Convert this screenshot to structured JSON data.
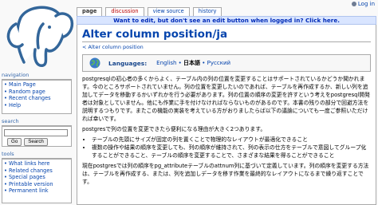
{
  "personal_tools": {
    "login": "Log in"
  },
  "tabs": [
    {
      "label": "page",
      "selected": true
    },
    {
      "label": "discussion",
      "new": true
    },
    {
      "label": "view source"
    },
    {
      "label": "history"
    }
  ],
  "notice": "Want to edit, but don't see an edit button when logged in?  Click here.",
  "title": "Alter column position/ja",
  "breadcrumb": "< Alter column position",
  "languages": {
    "label": "Languages:",
    "links": [
      "English",
      "日本語",
      "Русский"
    ],
    "separator": "•"
  },
  "content": {
    "p1": "postgresqlの初心者の多くからよく、テーブル内の列の位置を変更することはサポートされているかどうか聞かれます。今のところサポートされていません。列の位置を変更したいのであれば、テーブルを再作成するか、新しい列を追加してデータを移動するかいずれかを行う必要があります。列の位置の順序の変更を許すという考えをpostgresql開発者は対象としていません。他にも作業に手を付けなければならないものがあるのです。本書の残りの部分で回避方法を説明するつもりです。またこの機能の実装を考えている方がおりましたらば以下の議論についても一度ご参照いただければ幸いです。",
    "p2": "postgresで列の位置を変更できたら便利になる理由が大きく2つあります。",
    "reasons": [
      "テーブルの先頭にサイズが固定の列を置くことで物理的なレイアウトが最適化できること",
      "複数の操作や結果の順序を変更しても、列の順序が維持されて、列の表示の仕方をテーブルで意図してグループ化することができること、テーブルの順序を変更することで、さまざまな結果を得ることができること"
    ],
    "p3": "現在postgresでは列の順序をpg_attributeテーブルのattnum列に基づいて定義しています。列の順序を変更する方法は、テーブルを再作成する、または、列を追加しデータを移す作業を最終的なレイアウトになるまで繰り返すことです。"
  },
  "sidebar": {
    "navigation": {
      "title": "navigation",
      "items": [
        "Main Page",
        "Random page",
        "Recent changes",
        "Help"
      ]
    },
    "search": {
      "title": "search",
      "go": "Go",
      "search": "Search"
    },
    "tools": {
      "title": "tools",
      "items": [
        "What links here",
        "Related changes",
        "Special pages",
        "Printable version",
        "Permanent link"
      ]
    }
  }
}
